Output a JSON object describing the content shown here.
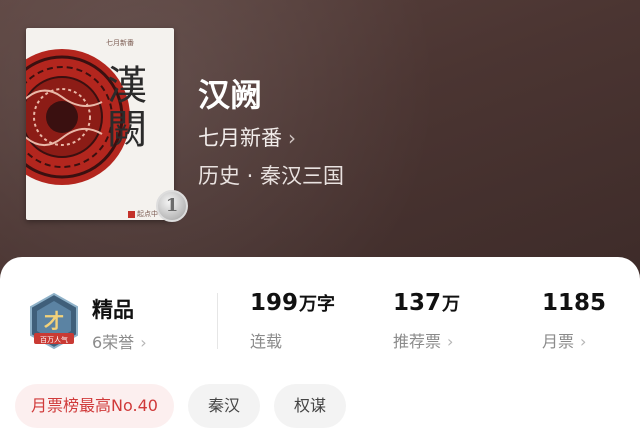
{
  "book": {
    "title": "汉阙",
    "author": "七月新番",
    "genre": "历史 · 秦汉三国",
    "cover": {
      "title_text": "漢闕",
      "author_small": "七月新番",
      "publisher_small": "起点中"
    },
    "volume_badge": "1"
  },
  "honor": {
    "badge_level": "精品",
    "honor_count": "6荣誉",
    "badge_caption": "百万人气"
  },
  "stats": [
    {
      "value": "199",
      "unit": "万字",
      "label": "连载",
      "has_chevron": false
    },
    {
      "value": "137",
      "unit": "万",
      "label": "推荐票",
      "has_chevron": true
    },
    {
      "value": "1185",
      "unit": "",
      "label": "月票",
      "has_chevron": true
    }
  ],
  "tags": [
    "月票榜最高No.40",
    "秦汉",
    "权谋"
  ],
  "chevron": "›",
  "colors": {
    "hero_bg": "#4b3532",
    "rank_tag_text": "#d03a3a",
    "rank_tag_bg": "#fcefef"
  }
}
